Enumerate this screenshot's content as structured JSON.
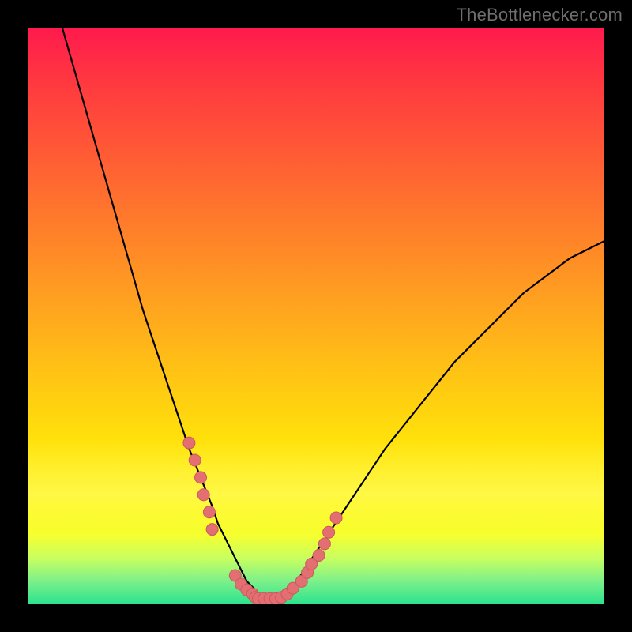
{
  "watermark": "TheBottlenecker.com",
  "colors": {
    "border": "#000000",
    "curve": "#000000",
    "dot_fill": "#e46f72",
    "dot_stroke": "#c85a5d"
  },
  "chart_data": {
    "type": "line",
    "title": "",
    "xlabel": "",
    "ylabel": "",
    "xlim": [
      0,
      100
    ],
    "ylim": [
      0,
      100
    ],
    "series": [
      {
        "name": "bottleneck-curve",
        "x": [
          6,
          8,
          10,
          12,
          14,
          16,
          18,
          20,
          22,
          24,
          26,
          28,
          30,
          32,
          33,
          34,
          35,
          36,
          37,
          38,
          39,
          40,
          41,
          42,
          43,
          44,
          46,
          48,
          50,
          54,
          58,
          62,
          66,
          70,
          74,
          78,
          82,
          86,
          90,
          94,
          98,
          100
        ],
        "y": [
          100,
          93,
          86,
          79,
          72,
          65,
          58,
          51,
          45,
          39,
          33,
          27,
          22,
          17,
          14,
          12,
          10,
          8,
          6,
          4,
          3,
          2,
          1.3,
          1,
          1,
          1.3,
          3,
          6,
          9,
          15,
          21,
          27,
          32,
          37,
          42,
          46,
          50,
          54,
          57,
          60,
          62,
          63
        ]
      }
    ],
    "scatter_points": {
      "name": "marker-cluster",
      "x": [
        28,
        29,
        30,
        30.5,
        31.5,
        32,
        36,
        37,
        38,
        39,
        39.5,
        40,
        41,
        42,
        43,
        44,
        45,
        46,
        47.5,
        48.5,
        49.2,
        50.5,
        51.5,
        52.2,
        53.5
      ],
      "y": [
        28,
        25,
        22,
        19,
        16,
        13,
        5,
        3.5,
        2.5,
        1.8,
        1.2,
        1,
        1,
        1,
        1,
        1.2,
        1.8,
        2.8,
        4,
        5.5,
        7,
        8.5,
        10.5,
        12.5,
        15
      ]
    }
  }
}
